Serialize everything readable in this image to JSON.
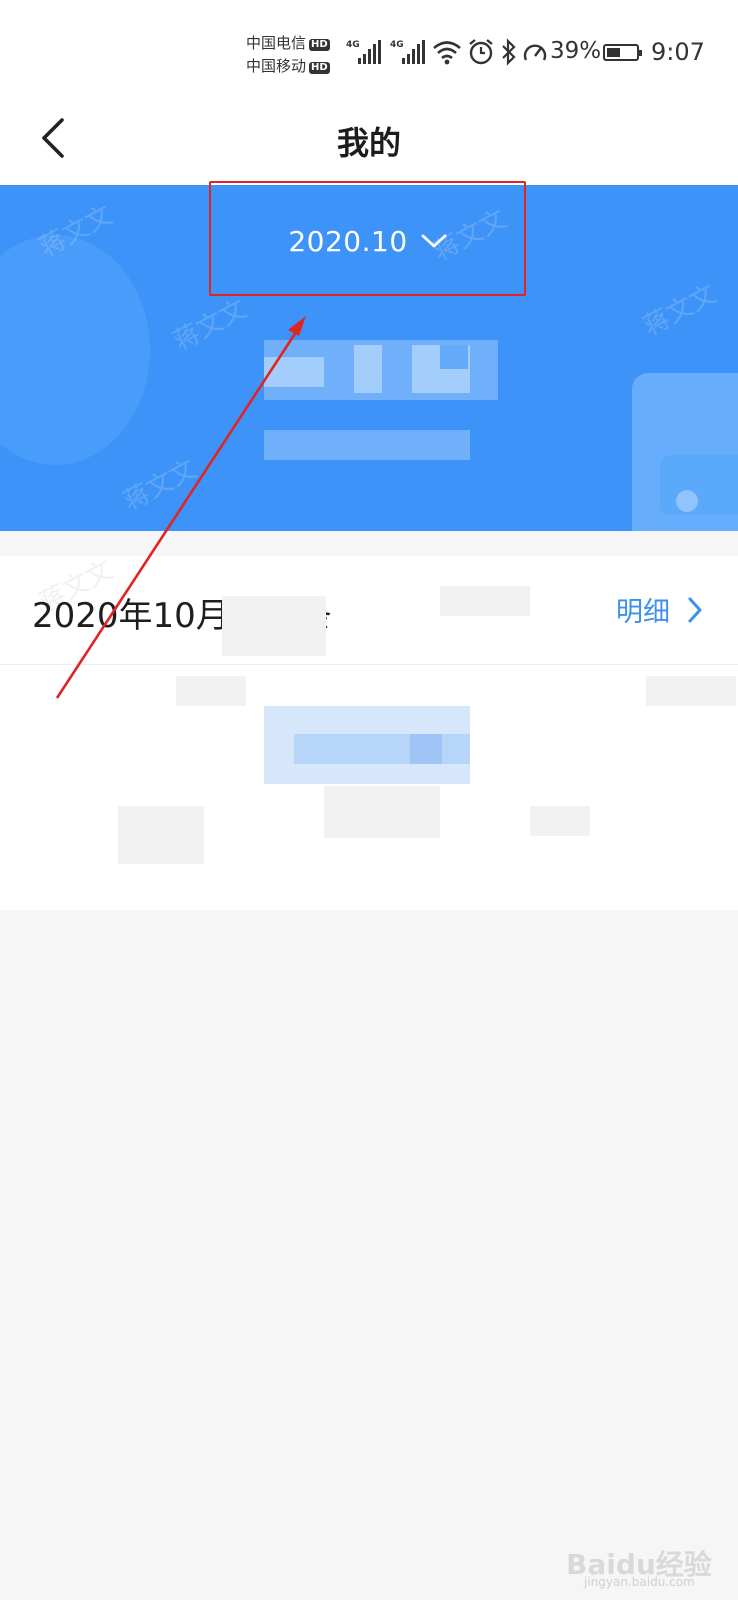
{
  "status_bar": {
    "carrier1": "中国电信",
    "carrier2": "中国移动",
    "hd_label": "HD",
    "network_label": "4G",
    "battery_percent": "39%",
    "time": "9:07",
    "icons": [
      "signal-icon",
      "wifi-icon",
      "alarm-icon",
      "bluetooth-icon",
      "speed-icon",
      "battery-icon"
    ]
  },
  "nav": {
    "title": "我的",
    "back_icon": "chevron-left-icon"
  },
  "banner": {
    "month": "2020.10",
    "month_icon": "chevron-down-icon",
    "watermark": "蒋文文",
    "color": "#3d93f7"
  },
  "salary": {
    "title": "2020年10月工资条",
    "detail_label": "明细",
    "detail_icon": "chevron-right-icon",
    "accent": "#3d8ff0"
  },
  "annotation": {
    "highlight_color": "#e02424"
  },
  "brand": {
    "logo": "Baidu经验",
    "url": "jingyan.baidu.com"
  }
}
